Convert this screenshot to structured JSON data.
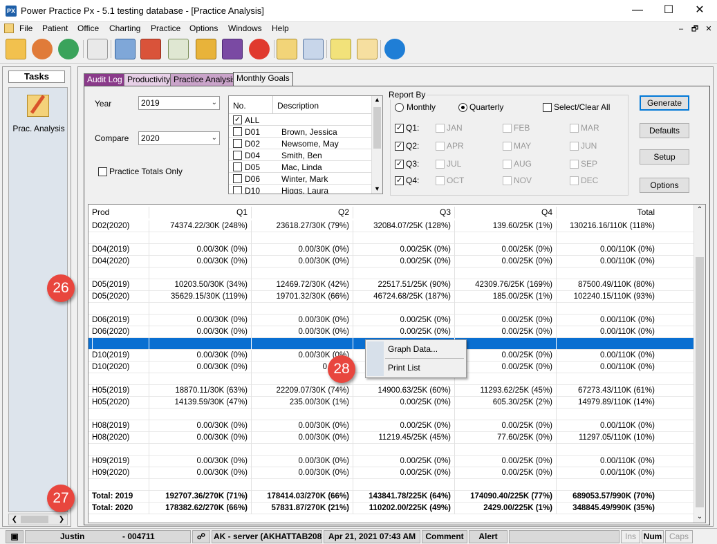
{
  "window": {
    "app_icon": "PX",
    "title": "Power Practice Px - 5.1 testing database - [Practice Analysis]",
    "controls": [
      "minimize-icon",
      "maximize-icon",
      "close-icon"
    ]
  },
  "menu": {
    "items": [
      "File",
      "Patient",
      "Office",
      "Charting",
      "Practice",
      "Options",
      "Windows",
      "Help"
    ],
    "mdi_controls": [
      "–",
      "🗗",
      "✕"
    ]
  },
  "toolbar": {
    "icons": [
      "open-folder-icon",
      "patients-icon",
      "refresh-money-icon",
      "edit-pencil-icon",
      "book-icon",
      "calendar-icon",
      "checklist-icon",
      "gift-box-icon",
      "edi-icon",
      "stop-icon",
      "documents-icon",
      "bottle-icon",
      "notepad-icon",
      "notes-icon",
      "help-circle-icon"
    ]
  },
  "tasks": {
    "header": "Tasks",
    "item_label": "Prac. Analysis"
  },
  "tabs": [
    "Audit Log",
    "Productivity",
    "Practice Analysis",
    "Monthly Goals"
  ],
  "filters": {
    "year_label": "Year",
    "year_value": "2019",
    "compare_label": "Compare",
    "compare_value": "2020",
    "totals_only_label": "Practice Totals Only",
    "list_header_no": "No.",
    "list_header_desc": "Description",
    "providers": [
      {
        "no": "ALL",
        "desc": "",
        "checked": true
      },
      {
        "no": "D01",
        "desc": "Brown, Jessica",
        "checked": false
      },
      {
        "no": "D02",
        "desc": "Newsome, May",
        "checked": false
      },
      {
        "no": "D04",
        "desc": "Smith, Ben",
        "checked": false
      },
      {
        "no": "D05",
        "desc": "Mac, Linda",
        "checked": false
      },
      {
        "no": "D06",
        "desc": "Winter, Mark",
        "checked": false
      },
      {
        "no": "D10",
        "desc": "Higgs, Laura",
        "checked": false
      }
    ],
    "check_mark": "✓"
  },
  "report_by": {
    "label": "Report By",
    "monthly": "Monthly",
    "quarterly": "Quarterly",
    "select_all": "Select/Clear All",
    "quarters": [
      "Q1:",
      "Q2:",
      "Q3:",
      "Q4:"
    ],
    "months": [
      "JAN",
      "FEB",
      "MAR",
      "APR",
      "MAY",
      "JUN",
      "JUL",
      "AUG",
      "SEP",
      "OCT",
      "NOV",
      "DEC"
    ]
  },
  "buttons": {
    "generate": "Generate",
    "defaults": "Defaults",
    "setup": "Setup",
    "options": "Options"
  },
  "grid": {
    "headers": [
      "Prod",
      "Q1",
      "Q2",
      "Q3",
      "Q4",
      "Total"
    ],
    "rows": [
      [
        "D02(2020)",
        "74374.22/30K (248%)",
        "23618.27/30K (79%)",
        "32084.07/25K (128%)",
        "139.60/25K (1%)",
        "130216.16/110K (118%)"
      ],
      [
        "",
        "",
        "",
        "",
        "",
        ""
      ],
      [
        "D04(2019)",
        "0.00/30K (0%)",
        "0.00/30K (0%)",
        "0.00/25K (0%)",
        "0.00/25K (0%)",
        "0.00/110K (0%)"
      ],
      [
        "D04(2020)",
        "0.00/30K (0%)",
        "0.00/30K (0%)",
        "0.00/25K (0%)",
        "0.00/25K (0%)",
        "0.00/110K (0%)"
      ],
      [
        "",
        "",
        "",
        "",
        "",
        ""
      ],
      [
        "D05(2019)",
        "10203.50/30K (34%)",
        "12469.72/30K (42%)",
        "22517.51/25K (90%)",
        "42309.76/25K (169%)",
        "87500.49/110K (80%)"
      ],
      [
        "D05(2020)",
        "35629.15/30K (119%)",
        "19701.32/30K (66%)",
        "46724.68/25K (187%)",
        "185.00/25K (1%)",
        "102240.15/110K (93%)"
      ],
      [
        "",
        "",
        "",
        "",
        "",
        ""
      ],
      [
        "D06(2019)",
        "0.00/30K (0%)",
        "0.00/30K (0%)",
        "0.00/25K (0%)",
        "0.00/25K (0%)",
        "0.00/110K (0%)"
      ],
      [
        "D06(2020)",
        "0.00/30K (0%)",
        "0.00/30K (0%)",
        "0.00/25K (0%)",
        "0.00/25K (0%)",
        "0.00/110K (0%)"
      ],
      [
        "",
        "",
        "",
        "",
        "",
        ""
      ],
      [
        "D10(2019)",
        "0.00/30K (0%)",
        "0.00/30K (0%)",
        "",
        "0.00/25K (0%)",
        "0.00/110K (0%)"
      ],
      [
        "D10(2020)",
        "0.00/30K (0%)",
        "0.00/30",
        "",
        "0.00/25K (0%)",
        "0.00/110K (0%)"
      ],
      [
        "",
        "",
        "",
        "",
        "",
        ""
      ],
      [
        "H05(2019)",
        "18870.11/30K (63%)",
        "22209.07/30K (74%)",
        "14900.63/25K (60%)",
        "11293.62/25K (45%)",
        "67273.43/110K (61%)"
      ],
      [
        "H05(2020)",
        "14139.59/30K (47%)",
        "235.00/30K (1%)",
        "0.00/25K (0%)",
        "605.30/25K (2%)",
        "14979.89/110K (14%)"
      ],
      [
        "",
        "",
        "",
        "",
        "",
        ""
      ],
      [
        "H08(2019)",
        "0.00/30K (0%)",
        "0.00/30K (0%)",
        "0.00/25K (0%)",
        "0.00/25K (0%)",
        "0.00/110K (0%)"
      ],
      [
        "H08(2020)",
        "0.00/30K (0%)",
        "0.00/30K (0%)",
        "11219.45/25K (45%)",
        "77.60/25K (0%)",
        "11297.05/110K (10%)"
      ],
      [
        "",
        "",
        "",
        "",
        "",
        ""
      ],
      [
        "H09(2019)",
        "0.00/30K (0%)",
        "0.00/30K (0%)",
        "0.00/25K (0%)",
        "0.00/25K (0%)",
        "0.00/110K (0%)"
      ],
      [
        "H09(2020)",
        "0.00/30K (0%)",
        "0.00/30K (0%)",
        "0.00/25K (0%)",
        "0.00/25K (0%)",
        "0.00/110K (0%)"
      ],
      [
        "",
        "",
        "",
        "",
        "",
        ""
      ],
      [
        "Total: 2019",
        "192707.36/270K (71%)",
        "178414.03/270K (66%)",
        "143841.78/225K (64%)",
        "174090.40/225K (77%)",
        "689053.57/990K (70%)"
      ],
      [
        "Total: 2020",
        "178382.62/270K (66%)",
        "57831.87/270K (21%)",
        "110202.00/225K (49%)",
        "2429.00/225K (1%)",
        "348845.49/990K (35%)"
      ]
    ],
    "selected_row_index": 10
  },
  "context_menu": {
    "items": [
      "Graph Data...",
      "Print List"
    ]
  },
  "callouts": [
    "26",
    "27",
    "28"
  ],
  "statusbar": {
    "user": "Justin",
    "code": "- 004711",
    "server": "AK - server (AKHATTAB208",
    "datetime": "Apr 21, 2021 07:43 AM",
    "comment": "Comment",
    "alert": "Alert",
    "ins": "Ins",
    "num": "Num",
    "caps": "Caps"
  },
  "colors": {
    "selection": "#0a6fd1",
    "callout": "#e8463e",
    "audit_tab": "#8a3a8a"
  }
}
